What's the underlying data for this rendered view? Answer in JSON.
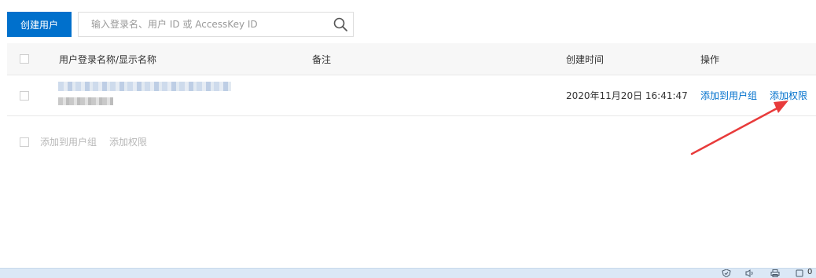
{
  "toolbar": {
    "create_user_label": "创建用户",
    "search_placeholder": "输入登录名、用户 ID 或 AccessKey ID"
  },
  "table": {
    "columns": [
      "用户登录名称/显示名称",
      "备注",
      "创建时间",
      "操作"
    ],
    "rows": [
      {
        "created_at": "2020年11月20日 16:41:47",
        "actions": [
          "添加到用户组",
          "添加权限"
        ]
      }
    ]
  },
  "footer": {
    "actions": [
      "添加到用户组",
      "添加权限"
    ]
  },
  "statusbar": {
    "right_text": "0"
  },
  "colors": {
    "primary": "#0070cc",
    "annotation_arrow": "#e83b3b"
  },
  "icons": [
    "search-icon",
    "arrow-annotation",
    "shield-icon",
    "speaker-icon",
    "printer-icon",
    "battery-icon"
  ]
}
